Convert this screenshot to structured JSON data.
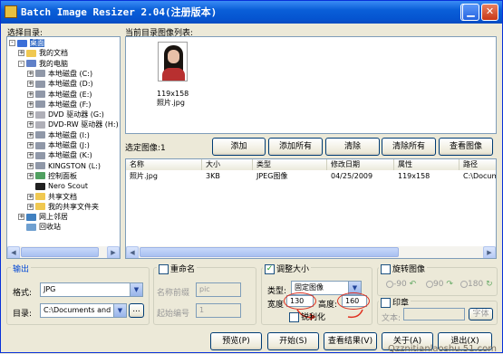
{
  "window": {
    "title": "Batch Image Resizer 2.04(注册版本)"
  },
  "left": {
    "label": "选择目录:",
    "tree": [
      {
        "label": "桌面",
        "icon": "desktop-icon",
        "pm": "-"
      },
      {
        "label": "我的文档",
        "icon": "folder-icon",
        "pm": "+"
      },
      {
        "label": "我的电脑",
        "icon": "computer-icon",
        "pm": "-"
      },
      {
        "label": "本地磁盘 (C:)",
        "icon": "drive-icon",
        "pm": "+"
      },
      {
        "label": "本地磁盘 (D:)",
        "icon": "drive-icon",
        "pm": "+"
      },
      {
        "label": "本地磁盘 (E:)",
        "icon": "drive-icon",
        "pm": "+"
      },
      {
        "label": "本地磁盘 (F:)",
        "icon": "drive-icon",
        "pm": "+"
      },
      {
        "label": "DVD 驱动器 (G:)",
        "icon": "dvd-icon",
        "pm": "+"
      },
      {
        "label": "DVD-RW 驱动器 (H:)",
        "icon": "dvd-icon",
        "pm": "+"
      },
      {
        "label": "本地磁盘 (I:)",
        "icon": "drive-icon",
        "pm": "+"
      },
      {
        "label": "本地磁盘 (J:)",
        "icon": "drive-icon",
        "pm": "+"
      },
      {
        "label": "本地磁盘 (K:)",
        "icon": "drive-icon",
        "pm": "+"
      },
      {
        "label": "KINGSTON (L:)",
        "icon": "drive-icon",
        "pm": "+"
      },
      {
        "label": "控制面板",
        "icon": "control-panel-icon",
        "pm": "+"
      },
      {
        "label": "Nero Scout",
        "icon": "nero-icon",
        "pm": ""
      },
      {
        "label": "共享文档",
        "icon": "folder-icon",
        "pm": "+"
      },
      {
        "label": "我的共享文件夹",
        "icon": "folder-icon",
        "pm": "+"
      },
      {
        "label": "网上邻居",
        "icon": "network-icon",
        "pm": "+"
      },
      {
        "label": "回收站",
        "icon": "recycle-bin-icon",
        "pm": ""
      }
    ]
  },
  "preview": {
    "label": "当前目录图像列表:",
    "thumb_size": "119x158",
    "thumb_name": "照片.jpg"
  },
  "selected": {
    "label": "选定图像:",
    "count": "1",
    "buttons": {
      "add": "添加",
      "add_all": "添加所有",
      "clear": "清除",
      "clear_all": "清除所有",
      "view": "查看图像"
    },
    "columns": [
      "名称",
      "大小",
      "类型",
      "修改日期",
      "属性",
      "路径"
    ],
    "rows": [
      [
        "照片.jpg",
        "3KB",
        "JPEG图像",
        "04/25/2009",
        "119x158",
        "C:\\Documents"
      ]
    ]
  },
  "output": {
    "title": "输出",
    "format_label": "格式:",
    "format_value": "JPG",
    "dir_label": "目录:",
    "dir_value": "C:\\Documents and S",
    "browse": "..."
  },
  "rename": {
    "title": "重命名",
    "prefix_label": "名称前缀",
    "prefix_value": "pic",
    "start_label": "起始编号",
    "start_value": "1"
  },
  "resize": {
    "title": "调整大小",
    "type_label": "类型:",
    "type_value": "固定图像",
    "width_label": "宽度",
    "width_value": "130",
    "height_label": "高度:",
    "height_value": "160",
    "sharpen": "锐利化"
  },
  "rotate": {
    "title": "旋转图像",
    "opt1": "-90",
    "opt2": "90",
    "opt3": "180"
  },
  "stamp": {
    "title": "印章",
    "text_label": "文本:",
    "font_btn": "字体"
  },
  "bottom": {
    "preview": "预览(P)",
    "start": "开始(S)",
    "view_result": "查看结果(V)",
    "about": "关于(A)",
    "exit": "退出(X)",
    "watermark": "Qzznitianlaoshu.51.com"
  },
  "colors": {
    "titlebar": "#0a5fd8",
    "highlight": "#e03020",
    "check": "#21a121"
  }
}
